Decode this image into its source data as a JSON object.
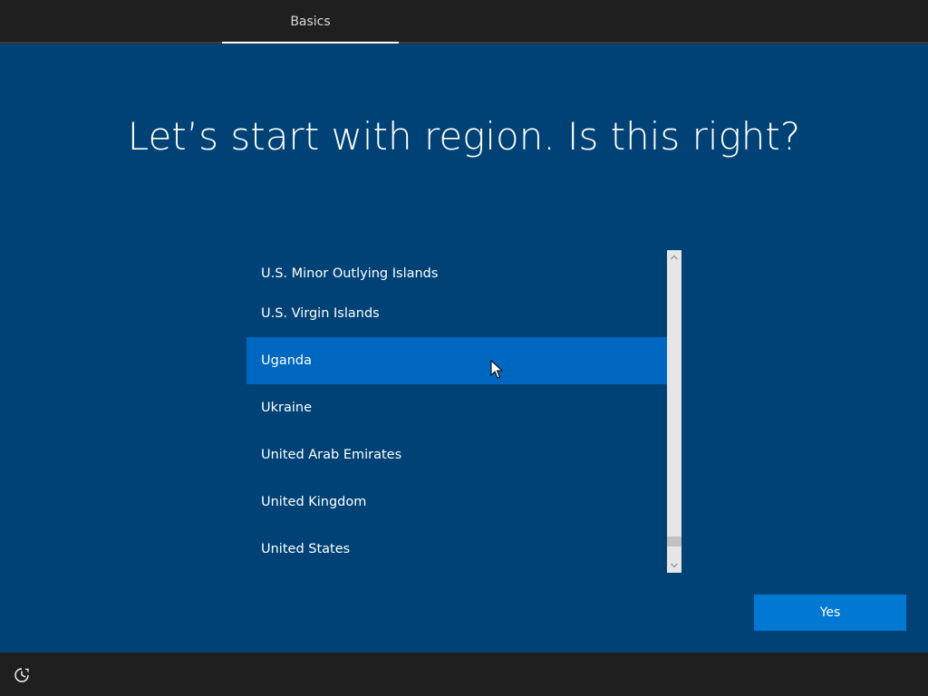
{
  "header": {
    "tab_label": "Basics"
  },
  "main": {
    "title": "Let’s start with region. Is this right?",
    "regions": [
      "U.S. Minor Outlying Islands",
      "U.S. Virgin Islands",
      "Uganda",
      "Ukraine",
      "United Arab Emirates",
      "United Kingdom",
      "United States"
    ],
    "selected_region": "Uganda",
    "yes_label": "Yes"
  },
  "footer": {
    "ease_of_access_icon": "ease-of-access-icon"
  },
  "colors": {
    "background": "#004275",
    "bars": "#1f1f1f",
    "selection": "#0067c0",
    "button": "#0078d4"
  }
}
